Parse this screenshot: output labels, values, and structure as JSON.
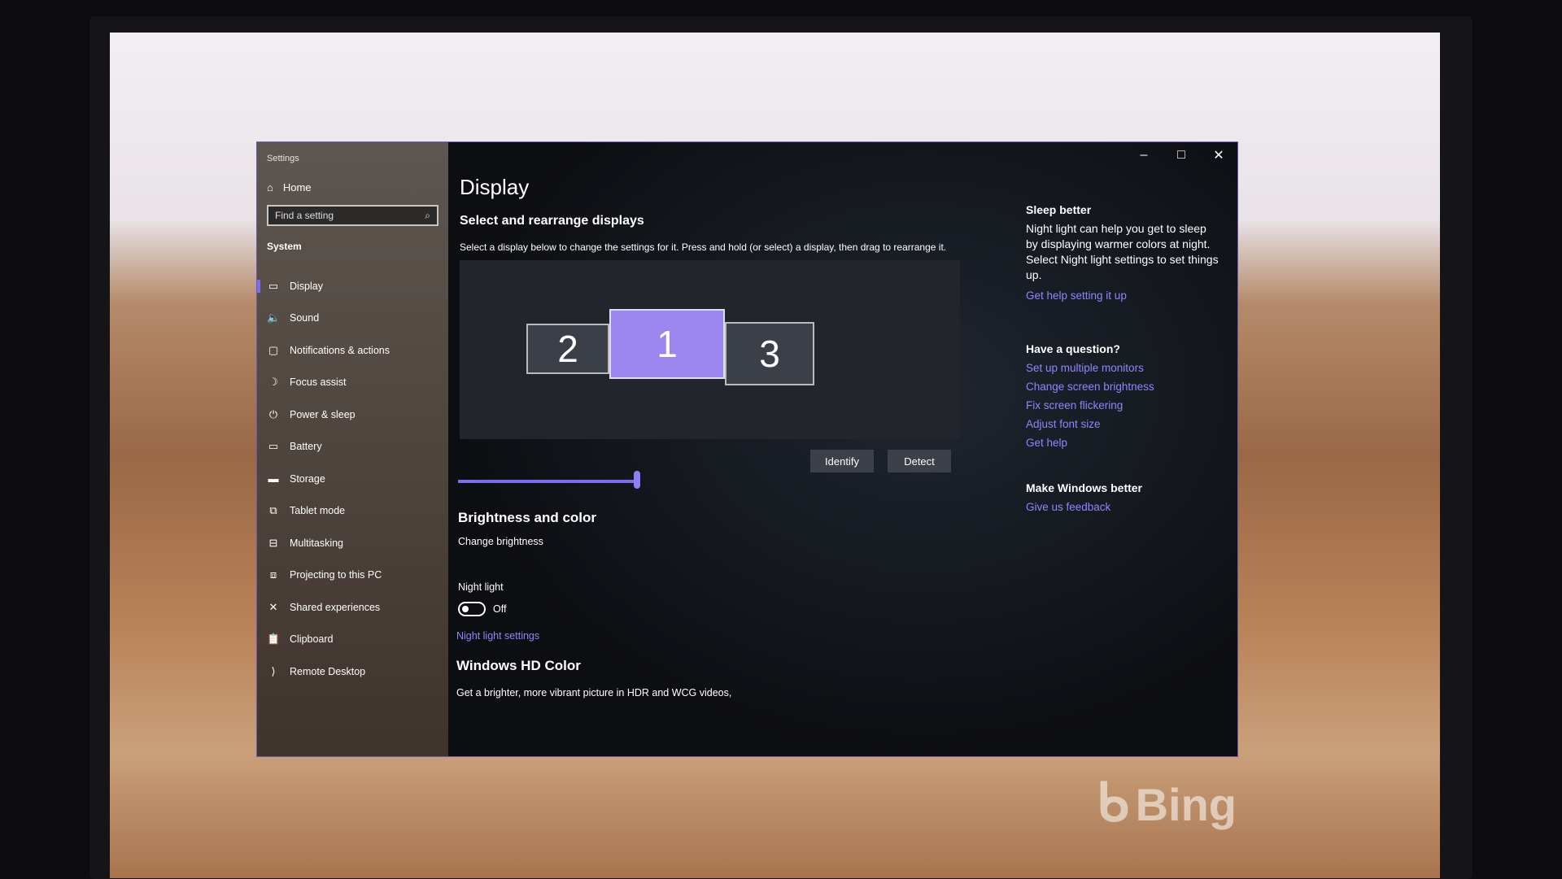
{
  "window": {
    "title": "Settings",
    "controls": {
      "minimize": "–",
      "maximize": "□",
      "close": "✕"
    }
  },
  "sidebar": {
    "home": "Home",
    "search_placeholder": "Find a setting",
    "section": "System",
    "items": [
      {
        "label": "Display",
        "icon": "monitor-icon",
        "glyph": "▭",
        "active": true
      },
      {
        "label": "Sound",
        "icon": "speaker-icon",
        "glyph": "🔈"
      },
      {
        "label": "Notifications & actions",
        "icon": "notification-icon",
        "glyph": "▢"
      },
      {
        "label": "Focus assist",
        "icon": "moon-icon",
        "glyph": "☽"
      },
      {
        "label": "Power & sleep",
        "icon": "power-icon",
        "glyph": "⏻"
      },
      {
        "label": "Battery",
        "icon": "battery-icon",
        "glyph": "▭"
      },
      {
        "label": "Storage",
        "icon": "storage-icon",
        "glyph": "▬"
      },
      {
        "label": "Tablet mode",
        "icon": "tablet-icon",
        "glyph": "⧉"
      },
      {
        "label": "Multitasking",
        "icon": "multitasking-icon",
        "glyph": "⊟"
      },
      {
        "label": "Projecting to this PC",
        "icon": "projecting-icon",
        "glyph": "⧈"
      },
      {
        "label": "Shared experiences",
        "icon": "shared-icon",
        "glyph": "✕"
      },
      {
        "label": "Clipboard",
        "icon": "clipboard-icon",
        "glyph": "📋"
      },
      {
        "label": "Remote Desktop",
        "icon": "remote-desktop-icon",
        "glyph": "⟩"
      }
    ]
  },
  "main": {
    "title": "Display",
    "arrange_heading": "Select and rearrange displays",
    "arrange_desc": "Select a display below to change the settings for it. Press and hold (or select) a display, then drag to rearrange it.",
    "monitors": [
      "2",
      "1",
      "3"
    ],
    "selected_monitor": "1",
    "identify": "Identify",
    "detect": "Detect",
    "brightness_heading": "Brightness and color",
    "brightness_label": "Change brightness",
    "brightness_value_percent": 100,
    "night_light_label": "Night light",
    "night_light_state": "Off",
    "night_light_link": "Night light settings",
    "hd_heading": "Windows HD Color",
    "hd_desc": "Get a brighter, more vibrant picture in HDR and WCG videos,"
  },
  "right": {
    "sleep_heading": "Sleep better",
    "sleep_text": "Night light can help you get to sleep by displaying warmer colors at night. Select Night light settings to set things up.",
    "sleep_link": "Get help setting it up",
    "question_heading": "Have a question?",
    "links": [
      "Set up multiple monitors",
      "Change screen brightness",
      "Fix screen flickering",
      "Adjust font size",
      "Get help"
    ],
    "feedback_heading": "Make Windows better",
    "feedback_link": "Give us feedback"
  },
  "wallpaper": {
    "watermark": "Bing"
  },
  "colors": {
    "accent": "#7b6cf0",
    "link": "#8f86ff",
    "selected_monitor": "#9a86ee"
  }
}
